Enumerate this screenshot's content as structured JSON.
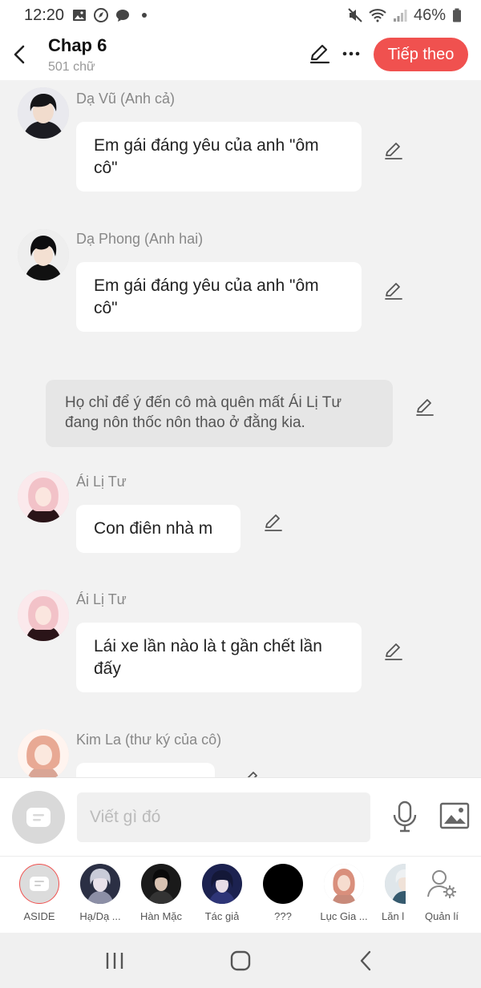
{
  "status_bar": {
    "time": "12:20",
    "battery": "46%"
  },
  "header": {
    "title": "Chap 6",
    "subtitle": "501 chữ",
    "next_label": "Tiếp theo"
  },
  "messages": [
    {
      "speaker": "Dạ Vũ (Anh cả)",
      "lines": [
        "Em gái đáng yêu của anh \"ôm",
        "cô\""
      ]
    },
    {
      "speaker": "Dạ Phong (Anh hai)",
      "lines": [
        "Em gái đáng yêu của anh \"ôm",
        "cô\""
      ]
    },
    {
      "narration": [
        "Họ chỉ để ý đến cô mà quên mất Ái Lị Tư",
        "đang nôn thốc nôn thao ở đằng kia."
      ]
    },
    {
      "speaker": "Ái Lị Tư",
      "lines": [
        "Con điên nhà m"
      ]
    },
    {
      "speaker": "Ái Lị Tư",
      "lines": [
        "Lái xe lần nào là t gần chết lần",
        "đấy"
      ]
    },
    {
      "speaker": "Kim La (thư ký của cô)",
      "lines": [
        ""
      ]
    }
  ],
  "input": {
    "placeholder": "Viết gì đó"
  },
  "characters": [
    {
      "label": "ASIDE"
    },
    {
      "label": "Hạ/Dạ ..."
    },
    {
      "label": "Hàn Mặc"
    },
    {
      "label": "Tác giả"
    },
    {
      "label": "???"
    },
    {
      "label": "Lục Gia ..."
    },
    {
      "label": "Lăn l"
    },
    {
      "label": "Quản lí"
    }
  ],
  "colors": {
    "accent": "#f0514f",
    "bubble": "#ffffff",
    "narration": "#e6e6e6",
    "background": "#f2f2f2"
  }
}
